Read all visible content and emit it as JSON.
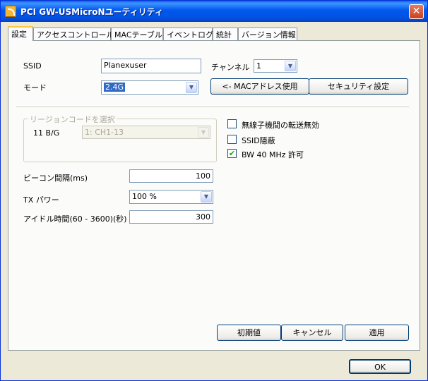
{
  "window": {
    "title": "PCI GW-USMicroNユーティリティ",
    "close_glyph": "✕"
  },
  "tabs": [
    {
      "label": "設定",
      "active": true
    },
    {
      "label": "アクセスコントロール",
      "active": false
    },
    {
      "label": "MACテーブル",
      "active": false
    },
    {
      "label": "イベントログ",
      "active": false
    },
    {
      "label": "統計",
      "active": false
    },
    {
      "label": "バージョン情報",
      "active": false
    }
  ],
  "settings": {
    "ssid_label": "SSID",
    "ssid_value": "Planexuser",
    "channel_label": "チャンネル",
    "channel_value": "1",
    "mode_label": "モード",
    "mode_value": "2.4G",
    "mac_button": "<- MACアドレス使用",
    "security_button": "セキュリティ設定",
    "region_group_label": "リージョンコードを選択",
    "region_band_label": "11 B/G",
    "region_value": "1: CH1-13",
    "wireless_isolation_label": "無線子機間の転送無効",
    "wireless_isolation_checked": false,
    "hide_ssid_label": "SSID隠蔽",
    "hide_ssid_checked": false,
    "bw40_label": "BW 40 MHz 許可",
    "bw40_checked": true,
    "check_glyph": "✔",
    "beacon_label": "ビーコン間隔(ms)",
    "beacon_value": "100",
    "tx_power_label": "TX パワー",
    "tx_power_value": "100 %",
    "idle_label": "アイドル時間(60 - 3600)(秒)",
    "idle_value": "300"
  },
  "footer": {
    "default_button": "初期値",
    "cancel_button": "キャンセル",
    "apply_button": "適用",
    "ok_button": "OK"
  },
  "icons": {
    "dropdown_arrow": "▼"
  },
  "colors": {
    "titlebar": "#0058EE",
    "window_bg": "#ECE9D8",
    "tab_highlight": "#FFC83C",
    "selection": "#316AC5",
    "check": "#21A121"
  }
}
